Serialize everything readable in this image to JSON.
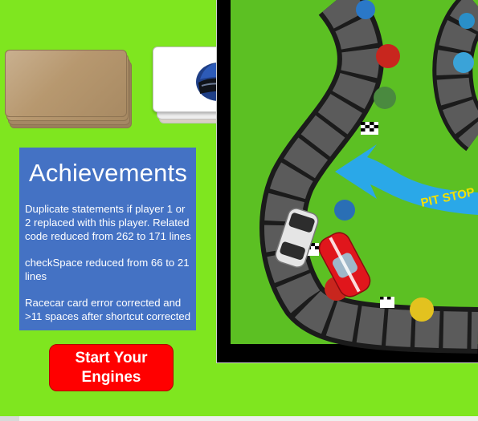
{
  "achievements": {
    "title": "Achievements",
    "items": [
      "Duplicate statements if player 1 or 2 replaced with this player.  Related code reduced from 262 to 171 lines",
      "checkSpace reduced from 66 to 21 lines",
      "Racecar card error corrected and >11 spaces after shortcut corrected"
    ]
  },
  "start_button": {
    "label_line1": "Start Your",
    "label_line2": "Engines"
  },
  "board": {
    "pit_stop_label": "PIT STOP"
  },
  "colors": {
    "background": "#7fe61f",
    "board_green": "#5cc023",
    "panel_blue": "#4472c4",
    "button_red": "#ff0000",
    "arrow_blue": "#2aa8e8"
  }
}
